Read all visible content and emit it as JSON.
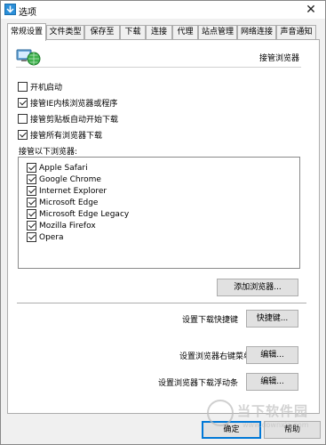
{
  "window": {
    "title": "选项",
    "close_glyph": "✕"
  },
  "tabs": [
    {
      "label": "常规设置",
      "active": true
    },
    {
      "label": "文件类型"
    },
    {
      "label": "保存至"
    },
    {
      "label": "下载"
    },
    {
      "label": "连接"
    },
    {
      "label": "代理"
    },
    {
      "label": "站点管理"
    },
    {
      "label": "网络连接"
    },
    {
      "label": "声音通知"
    }
  ],
  "panel": {
    "heading": "接管浏览器"
  },
  "options": [
    {
      "label": "开机启动",
      "checked": false
    },
    {
      "label": "接管IE内核浏览器或程序",
      "checked": true
    },
    {
      "label": "接管剪贴板自动开始下载",
      "checked": false
    },
    {
      "label": "接管所有浏览器下载",
      "checked": true
    }
  ],
  "browsers": {
    "label": "接管以下浏览器:",
    "items": [
      {
        "label": "Apple Safari",
        "checked": true
      },
      {
        "label": "Google Chrome",
        "checked": true
      },
      {
        "label": "Internet Explorer",
        "checked": true
      },
      {
        "label": "Microsoft Edge",
        "checked": true
      },
      {
        "label": "Microsoft Edge Legacy",
        "checked": true
      },
      {
        "label": "Mozilla Firefox",
        "checked": true
      },
      {
        "label": "Opera",
        "checked": true
      }
    ],
    "add_button": "添加浏览器..."
  },
  "shortcut": {
    "label": "设置下载快捷键",
    "button": "快捷键..."
  },
  "context_menu": {
    "label": "设置浏览器右键菜单",
    "button": "编辑..."
  },
  "float_bar": {
    "label": "设置浏览器下载浮动条",
    "button": "编辑..."
  },
  "footer": {
    "ok": "确定",
    "help": "帮助"
  },
  "watermark": {
    "text": "当下软件园",
    "url": "www.downxia.com"
  },
  "colors": {
    "accent": "#0078d7",
    "border": "#adadad"
  }
}
